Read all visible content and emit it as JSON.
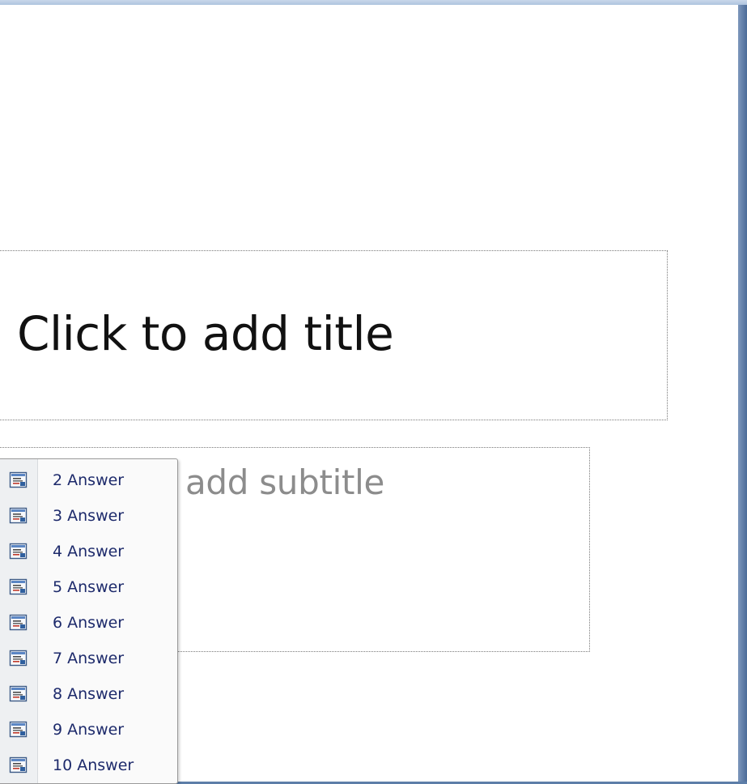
{
  "slide": {
    "title_placeholder": "Click to add title",
    "subtitle_placeholder": "add subtitle"
  },
  "menu": {
    "items": [
      {
        "label": "2 Answer",
        "icon": "slide-layout-icon"
      },
      {
        "label": "3 Answer",
        "icon": "slide-layout-icon"
      },
      {
        "label": "4 Answer",
        "icon": "slide-layout-icon"
      },
      {
        "label": "5 Answer",
        "icon": "slide-layout-icon"
      },
      {
        "label": "6 Answer",
        "icon": "slide-layout-icon"
      },
      {
        "label": "7 Answer",
        "icon": "slide-layout-icon"
      },
      {
        "label": "8 Answer",
        "icon": "slide-layout-icon"
      },
      {
        "label": "9 Answer",
        "icon": "slide-layout-icon"
      },
      {
        "label": "10 Answer",
        "icon": "slide-layout-icon"
      }
    ]
  },
  "colors": {
    "menu_text": "#1d2a6b",
    "subtitle_text": "#8c8c8c",
    "title_text": "#111111",
    "window_frame": "#5d7ea8"
  }
}
